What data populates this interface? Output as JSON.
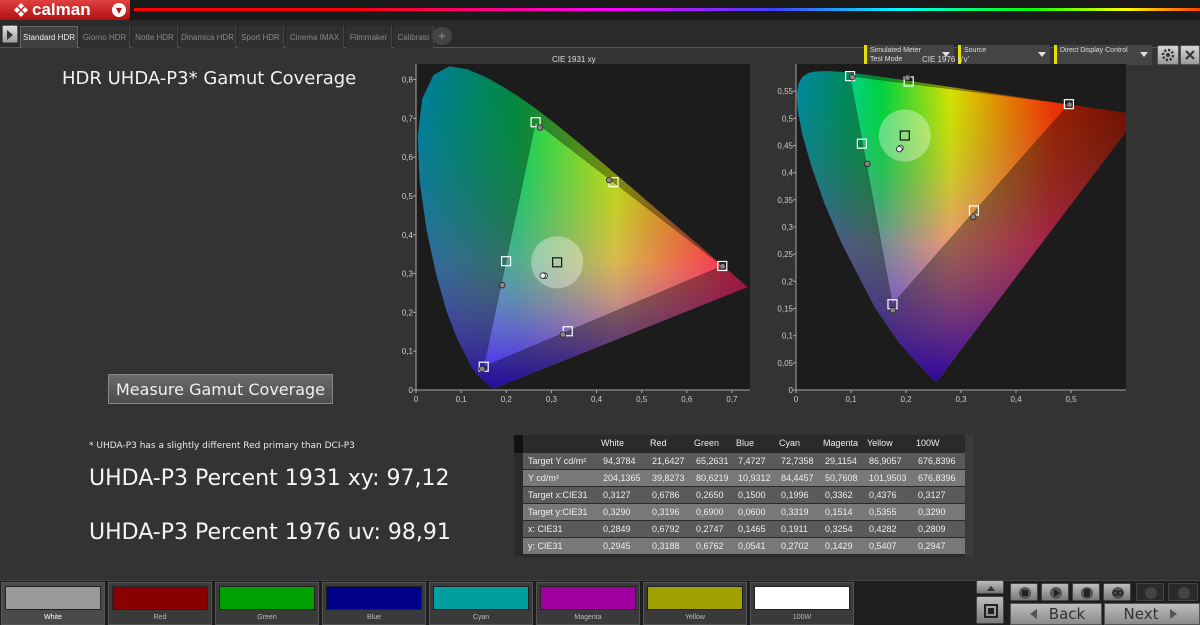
{
  "app": {
    "logo_text": "calman"
  },
  "tabs": [
    {
      "label": "Standard HDR",
      "active": true
    },
    {
      "label": "Giorno HDR"
    },
    {
      "label": "Notte HDR"
    },
    {
      "label": "Dinamica HDR"
    },
    {
      "label": "Sport HDR"
    },
    {
      "label": "Cinema IMAX"
    },
    {
      "label": "Filmmaker"
    },
    {
      "label": "Calibrato"
    }
  ],
  "devices": {
    "meter_line1": "Simulated Meter",
    "meter_line2": "Test Mode",
    "source": "Source",
    "display": "Direct Display Control"
  },
  "page": {
    "title": "HDR UHDA-P3* Gamut Coverage",
    "measure_button": "Measure Gamut Coverage",
    "note": "* UHDA-P3 has a slightly different Red primary than DCI-P3",
    "pct_1931": "UHDA-P3 Percent 1931 xy: 97,12",
    "pct_1976": "UHDA-P3 Percent 1976 uv: 98,91"
  },
  "chart_data": [
    {
      "type": "scatter",
      "title": "CIE 1931 xy",
      "xlim": [
        0,
        0.74
      ],
      "ylim": [
        0,
        0.84
      ],
      "xticks": [
        "0",
        "0,1",
        "0,2",
        "0,3",
        "0,4",
        "0,5",
        "0,6",
        "0,7"
      ],
      "yticks": [
        "0",
        "0,1",
        "0,2",
        "0,3",
        "0,4",
        "0,5",
        "0,6",
        "0,7",
        "0,8"
      ],
      "targets": [
        {
          "x": 0.6786,
          "y": 0.3196
        },
        {
          "x": 0.265,
          "y": 0.69
        },
        {
          "x": 0.15,
          "y": 0.06
        },
        {
          "x": 0.1996,
          "y": 0.3319
        },
        {
          "x": 0.3362,
          "y": 0.1514
        },
        {
          "x": 0.4376,
          "y": 0.5355
        },
        {
          "x": 0.3127,
          "y": 0.329
        }
      ],
      "measured": [
        {
          "x": 0.6792,
          "y": 0.3188
        },
        {
          "x": 0.2747,
          "y": 0.6762
        },
        {
          "x": 0.1465,
          "y": 0.0541
        },
        {
          "x": 0.1911,
          "y": 0.2702
        },
        {
          "x": 0.3254,
          "y": 0.1429
        },
        {
          "x": 0.4282,
          "y": 0.5407
        },
        {
          "x": 0.2849,
          "y": 0.2945
        },
        {
          "x": 0.2809,
          "y": 0.2947
        }
      ]
    },
    {
      "type": "scatter",
      "title": "CIE 1976 u'v'",
      "xlim": [
        0,
        0.6
      ],
      "ylim": [
        0,
        0.6
      ],
      "xticks": [
        "0",
        "0,1",
        "0,2",
        "0,3",
        "0,4",
        "0,5"
      ],
      "yticks": [
        "0",
        "0,05",
        "0,1",
        "0,15",
        "0,2",
        "0,25",
        "0,3",
        "0,35",
        "0,4",
        "0,45",
        "0,5",
        "0,55"
      ],
      "targets": [
        {
          "x": 0.4962,
          "y": 0.5261
        },
        {
          "x": 0.0983,
          "y": 0.5777
        },
        {
          "x": 0.1754,
          "y": 0.1579
        },
        {
          "x": 0.1198,
          "y": 0.4534
        },
        {
          "x": 0.3235,
          "y": 0.3305
        },
        {
          "x": 0.2049,
          "y": 0.5679
        },
        {
          "x": 0.1978,
          "y": 0.4683
        }
      ],
      "measured": [
        {
          "x": 0.4974,
          "y": 0.5252
        },
        {
          "x": 0.1026,
          "y": 0.5756
        },
        {
          "x": 0.176,
          "y": 0.1466
        },
        {
          "x": 0.1298,
          "y": 0.4162
        },
        {
          "x": 0.3222,
          "y": 0.3185
        },
        {
          "x": 0.2027,
          "y": 0.5748
        },
        {
          "x": 0.1901,
          "y": 0.4456
        },
        {
          "x": 0.1878,
          "y": 0.4434
        }
      ]
    }
  ],
  "table": {
    "columns": [
      "",
      "White",
      "Red",
      "Green",
      "Blue",
      "Cyan",
      "Magenta",
      "Yellow",
      "100W"
    ],
    "rows": [
      [
        "Target Y cd/m²",
        "94,3784",
        "21,6427",
        "65,2631",
        "7,4727",
        "72,7358",
        "29,1154",
        "86,9057",
        "676,8396"
      ],
      [
        "Y cd/m²",
        "204,1365",
        "39,8273",
        "80,6219",
        "10,9312",
        "84,4457",
        "50,7608",
        "101,9503",
        "676,8396"
      ],
      [
        "Target x:CIE31",
        "0,3127",
        "0,6786",
        "0,2650",
        "0,1500",
        "0,1996",
        "0,3362",
        "0,4376",
        "0,3127"
      ],
      [
        "Target y:CIE31",
        "0,3290",
        "0,3196",
        "0,6900",
        "0,0600",
        "0,3319",
        "0,1514",
        "0,5355",
        "0,3290"
      ],
      [
        "x: CIE31",
        "0,2849",
        "0,6792",
        "0,2747",
        "0,1465",
        "0,1911",
        "0,3254",
        "0,4282",
        "0,2809"
      ],
      [
        "y: CIE31",
        "0,2945",
        "0,3188",
        "0,6762",
        "0,0541",
        "0,2702",
        "0,1429",
        "0,5407",
        "0,2947"
      ]
    ]
  },
  "swatches": [
    {
      "label": "White",
      "color": "#9a9a9a",
      "active": true
    },
    {
      "label": "Red",
      "color": "#8a0000"
    },
    {
      "label": "Green",
      "color": "#00a000"
    },
    {
      "label": "Blue",
      "color": "#00008a"
    },
    {
      "label": "Cyan",
      "color": "#00a0a0"
    },
    {
      "label": "Magenta",
      "color": "#a000a0"
    },
    {
      "label": "Yellow",
      "color": "#a0a000"
    },
    {
      "label": "100W",
      "color": "#ffffff"
    }
  ],
  "nav": {
    "back": "Back",
    "next": "Next"
  }
}
